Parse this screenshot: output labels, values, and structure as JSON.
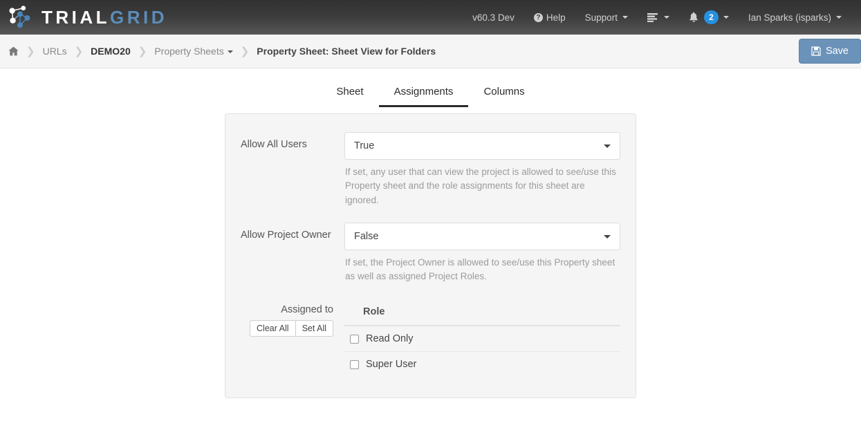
{
  "navbar": {
    "brand": {
      "part1": "TRIAL",
      "part2": "GRID",
      "logo_icon": "network-nodes-icon"
    },
    "version": "v60.3 Dev",
    "help": "Help",
    "support": "Support",
    "tasks_icon": "task-list-icon",
    "bell_icon": "bell-icon",
    "notification_count": "2",
    "user": "Ian Sparks (isparks)"
  },
  "breadcrumb": {
    "home_icon": "home-icon",
    "urls": "URLs",
    "project": "DEMO20",
    "property_sheets": "Property Sheets",
    "current": "Property Sheet: Sheet View for Folders",
    "separator": "❯"
  },
  "actions": {
    "save_label": "Save",
    "save_icon": "floppy-disk-icon"
  },
  "tabs": [
    {
      "label": "Sheet",
      "active": false
    },
    {
      "label": "Assignments",
      "active": true
    },
    {
      "label": "Columns",
      "active": false
    }
  ],
  "form": {
    "allow_all_users": {
      "label": "Allow All Users",
      "value": "True",
      "options": [
        "True",
        "False"
      ],
      "help": "If set, any user that can view the project is allowed to see/use this Property sheet and the role assignments for this sheet are ignored."
    },
    "allow_project_owner": {
      "label": "Allow Project Owner",
      "value": "False",
      "options": [
        "True",
        "False"
      ],
      "help": "If set, the Project Owner is allowed to see/use this Property sheet as well as assigned Project Roles."
    },
    "assigned_to": {
      "label": "Assigned to",
      "clear_all": "Clear All",
      "set_all": "Set All",
      "column_header": "Role",
      "roles": [
        {
          "name": "Read Only",
          "checked": false
        },
        {
          "name": "Super User",
          "checked": false
        }
      ]
    }
  },
  "colors": {
    "navbar_dark": "#3b3b3b",
    "brand_blue": "#5b8db8",
    "accent_blue": "#2591e0",
    "save_button": "#6b92b8",
    "panel_bg": "#f5f5f5",
    "page_bg": "#ffffff"
  }
}
